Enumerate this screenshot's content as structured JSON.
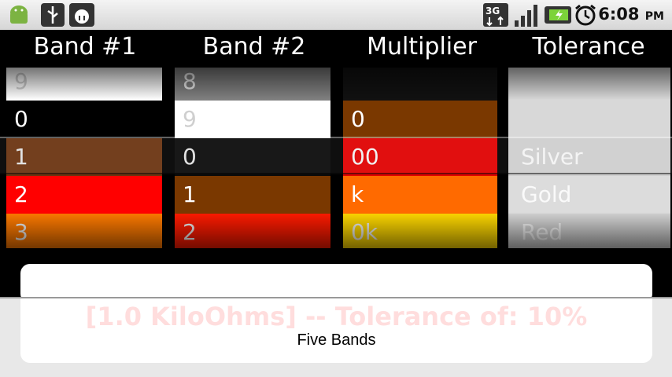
{
  "status": {
    "time": "6:08",
    "ampm": "PM",
    "network": "3G",
    "icons": [
      "android-icon",
      "usb-icon",
      "debug-icon",
      "network-3g-icon",
      "signal-icon",
      "battery-icon",
      "alarm-icon"
    ]
  },
  "headers": [
    "Band #1",
    "Band #2",
    "Multiplier",
    "Tolerance"
  ],
  "wheels": {
    "band1": [
      {
        "label": "9",
        "color": "#ffffff",
        "text": "#cfcfcf"
      },
      {
        "label": "0",
        "color": "#000000",
        "text": "#ffffff"
      },
      {
        "label": "1",
        "color": "#6b3410",
        "text": "#e0e0e0"
      },
      {
        "label": "2",
        "color": "#ff0000",
        "text": "#ffffff"
      },
      {
        "label": "3",
        "color": "#ff7a00",
        "text": "#f0f0f0"
      }
    ],
    "band2": [
      {
        "label": "8",
        "color": "#808080",
        "text": "#e8e8e8"
      },
      {
        "label": "9",
        "color": "#ffffff",
        "text": "#cfcfcf"
      },
      {
        "label": "0",
        "color": "#0a0a0a",
        "text": "#e0e0e0"
      },
      {
        "label": "1",
        "color": "#7a3800",
        "text": "#ffffff"
      },
      {
        "label": "2",
        "color": "#ff1a00",
        "text": "#f0f0f0"
      }
    ],
    "multiplier": [
      {
        "label": "",
        "color": "#111111",
        "text": "#ffffff"
      },
      {
        "label": "0",
        "color": "#7a3800",
        "text": "#ffffff"
      },
      {
        "label": "00",
        "color": "#e00000",
        "text": "#f0f0f0"
      },
      {
        "label": "k",
        "color": "#ff6a00",
        "text": "#ffffff"
      },
      {
        "label": "0k",
        "color": "#ffd800",
        "text": "#f0f0f0"
      }
    ],
    "tolerance": [
      {
        "label": "",
        "color": "#d8d8d8",
        "text": "#ffffff"
      },
      {
        "label": "",
        "color": "#d8d8d8",
        "text": "#ffffff"
      },
      {
        "label": "Silver",
        "color": "#cfcfcf",
        "text": "#f4f4f4"
      },
      {
        "label": "Gold",
        "color": "#dcdcdc",
        "text": "#fafafa"
      },
      {
        "label": "Red",
        "color": "#d2d2d2",
        "text": "#f4f4f4"
      }
    ]
  },
  "result_text": "[1.0 KiloOhms] -- Tolerance of: 10%",
  "mode_text": "Five Bands"
}
